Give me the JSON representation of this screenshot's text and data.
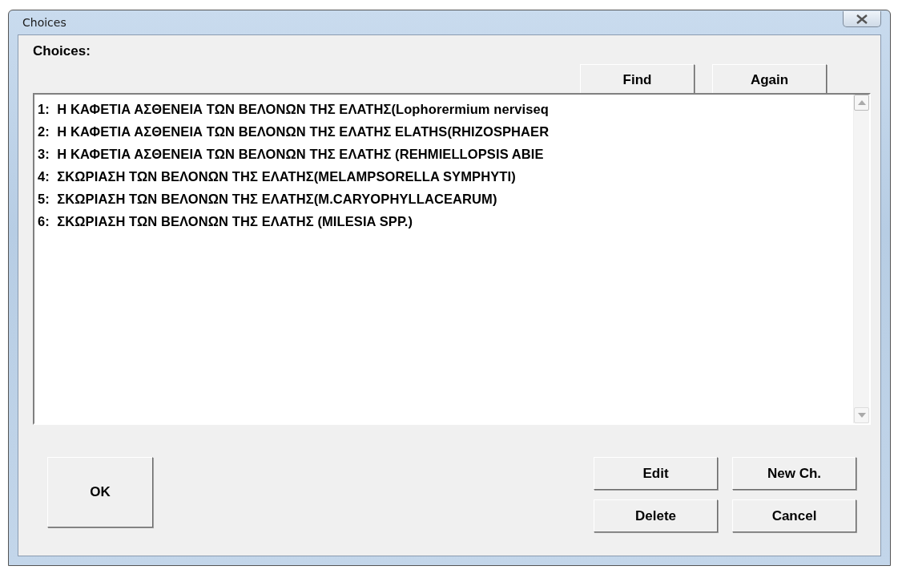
{
  "window": {
    "title": "Choices"
  },
  "choices_label": "Choices:",
  "top_buttons": [
    "Find",
    "Again"
  ],
  "list": {
    "items": [
      {
        "number": "1:",
        "text": "Η ΚΑΦΕΤΙΑ ΑΣΘΕΝΕΙΑ ΤΩΝ ΒΕΛΟΝΩΝ ΤΗΣ ΕΛΑΤΗΣ(Lophorermium nerviseq"
      },
      {
        "number": "2:",
        "text": "Η ΚΑΦΕΤΙΑ ΑΣΘΕΝΕΙΑ ΤΩΝ ΒΕΛΟΝΩΝ ΤΗΣ ΕΛΑΤΗΣ ELATHS(RHIZOSPHAER"
      },
      {
        "number": "3:",
        "text": "Η ΚΑΦΕΤΙΑ ΑΣΘΕΝΕΙΑ ΤΩΝ ΒΕΛΟΝΩΝ ΤΗΣ ΕΛΑΤΗΣ (REHMIELLOPSIS ABIE"
      },
      {
        "number": "4:",
        "text": "ΣΚΩΡΙΑΣΗ ΤΩΝ ΒΕΛΟΝΩΝ ΤΗΣ ΕΛΑΤΗΣ(MELAMPSORELLA SYMPHYTI)"
      },
      {
        "number": "5:",
        "text": "ΣΚΩΡΙΑΣΗ ΤΩΝ ΒΕΛΟΝΩΝ ΤΗΣ ΕΛΑΤΗΣ(M.CARYOPHYLLACEARUM)"
      },
      {
        "number": "6:",
        "text": "ΣΚΩΡΙΑΣΗ ΤΩΝ ΒΕΛΟΝΩΝ ΤΗΣ ΕΛΑΤΗΣ (MILESIA SPP.)"
      }
    ]
  },
  "ok_button": "OK",
  "action_buttons": [
    "Edit",
    "New Ch.",
    "Delete",
    "Cancel"
  ]
}
